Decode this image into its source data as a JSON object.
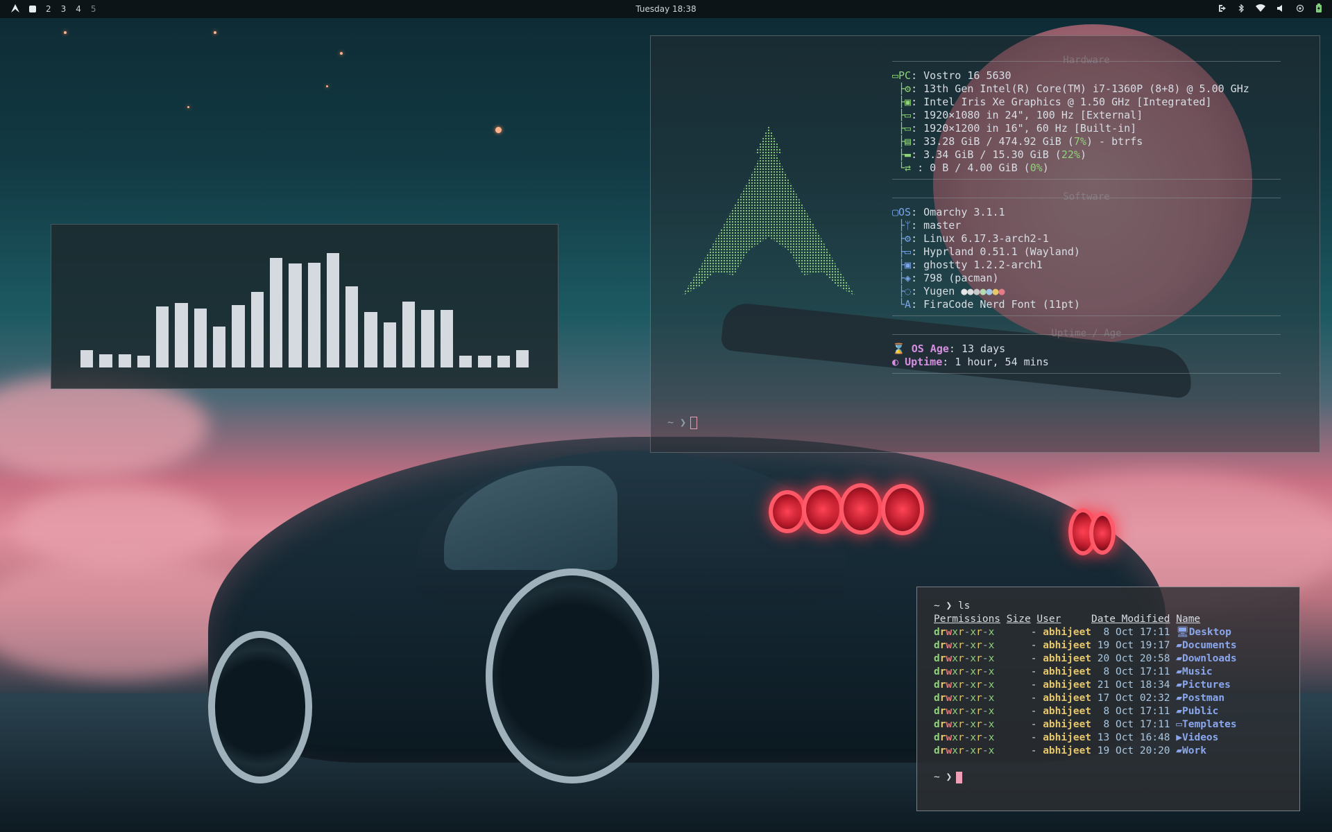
{
  "topbar": {
    "workspaces": [
      "2",
      "3",
      "4",
      "5"
    ],
    "clock": "Tuesday 18:38"
  },
  "visualizer": {
    "levels": [
      0.15,
      0.11,
      0.11,
      0.1,
      0.52,
      0.55,
      0.5,
      0.35,
      0.53,
      0.64,
      0.93,
      0.88,
      0.89,
      0.97,
      0.69,
      0.47,
      0.38,
      0.56,
      0.49,
      0.49,
      0.1,
      0.1,
      0.1,
      0.15
    ]
  },
  "fastfetch": {
    "hardware_title": "Hardware",
    "software_title": "Software",
    "uptime_title": "Uptime / Age",
    "pc_label": "PC",
    "pc_value": "Vostro 16 5630",
    "cpu": "13th Gen Intel(R) Core(TM) i7-1360P (8+8) @ 5.00 GHz",
    "gpu": "Intel Iris Xe Graphics @ 1.50 GHz [Integrated]",
    "display1": "1920×1080 in 24\", 100 Hz [External]",
    "display2": "1920×1200 in 16\", 60 Hz [Built-in]",
    "disk_a": "33.28 GiB / 474.92 GiB (",
    "disk_pct": "7%",
    "disk_b": ") - btrfs",
    "mem_a": "3.34 GiB / 15.30 GiB (",
    "mem_pct": "22%",
    "mem_b": ")",
    "swap_a": ": 0 B / 4.00 GiB (",
    "swap_pct": "0%",
    "swap_b": ")",
    "os_label": "OS",
    "os_value": "Omarchy 3.1.1",
    "branch": "master",
    "kernel": "Linux 6.17.3-arch2-1",
    "wm": "Hyprland 0.51.1 (Wayland)",
    "terminal": "ghostty 1.2.2-arch1",
    "packages": "798 (pacman)",
    "theme": "Yugen",
    "font": "FiraCode Nerd Font (11pt)",
    "os_age_label": "OS Age",
    "os_age_value": "13 days",
    "uptime_label": "Uptime",
    "uptime_value": "1 hour, 54 mins",
    "prompt": "~ ❯"
  },
  "ls_terminal": {
    "command": "~ ❯ ls",
    "headers": [
      "Permissions",
      "Size",
      "User",
      "Date Modified",
      "Name"
    ],
    "rows": [
      {
        "size": "-",
        "user": "abhijeet",
        "date": " 8 Oct 17:11",
        "name": "Desktop"
      },
      {
        "size": "-",
        "user": "abhijeet",
        "date": "19 Oct 19:17",
        "name": "Documents"
      },
      {
        "size": "-",
        "user": "abhijeet",
        "date": "20 Oct 20:58",
        "name": "Downloads"
      },
      {
        "size": "-",
        "user": "abhijeet",
        "date": " 8 Oct 17:11",
        "name": "Music"
      },
      {
        "size": "-",
        "user": "abhijeet",
        "date": "21 Oct 18:34",
        "name": "Pictures"
      },
      {
        "size": "-",
        "user": "abhijeet",
        "date": "17 Oct 02:32",
        "name": "Postman"
      },
      {
        "size": "-",
        "user": "abhijeet",
        "date": " 8 Oct 17:11",
        "name": "Public"
      },
      {
        "size": "-",
        "user": "abhijeet",
        "date": " 8 Oct 17:11",
        "name": "Templates"
      },
      {
        "size": "-",
        "user": "abhijeet",
        "date": "13 Oct 16:48",
        "name": "Videos"
      },
      {
        "size": "-",
        "user": "abhijeet",
        "date": "19 Oct 20:20",
        "name": "Work"
      }
    ],
    "prompt": "~ ❯"
  },
  "colors": {
    "accent_green": "#8fd27a",
    "accent_blue": "#7aa6e8",
    "accent_pink": "#f0a0b6"
  }
}
